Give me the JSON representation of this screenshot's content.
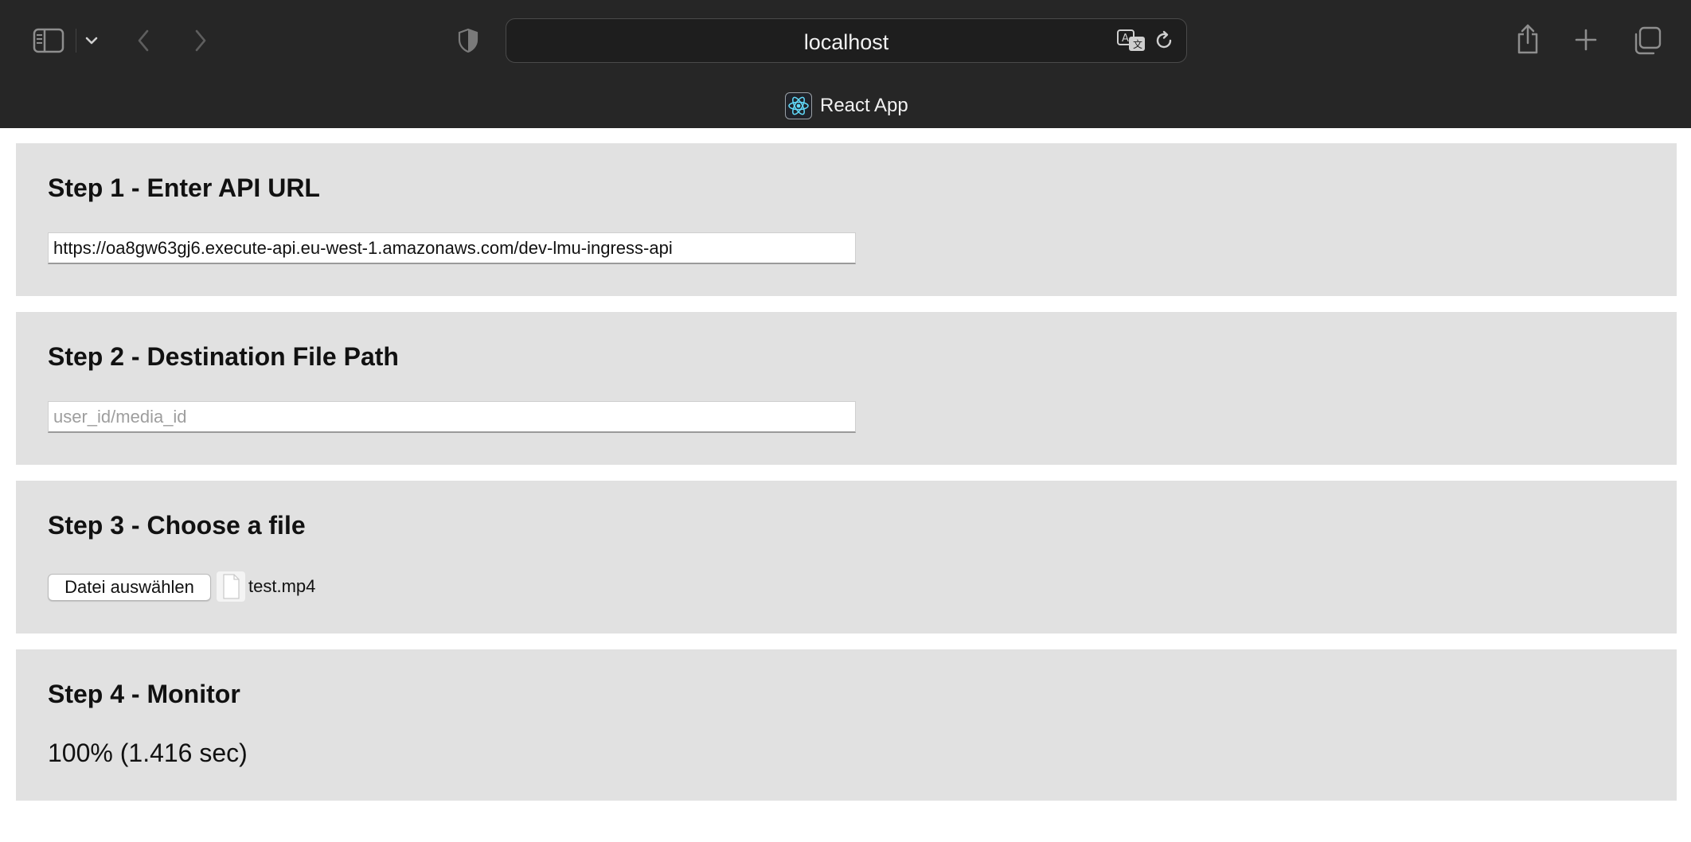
{
  "browser": {
    "url": "localhost",
    "tab_title": "React App",
    "icons": {
      "sidebar": "sidebar-icon",
      "sidebar_menu": "chevron-down-icon",
      "back": "chevron-left-icon",
      "forward": "chevron-right-icon",
      "privacy": "shield-icon",
      "translate": "translate-icon",
      "reload": "reload-icon",
      "share": "share-icon",
      "new_tab": "plus-icon",
      "tab_overview": "tabs-overview-icon",
      "favicon": "react-logo-icon"
    }
  },
  "steps": [
    {
      "title": "Step 1 - Enter API URL",
      "input_value": "https://oa8gw63gj6.execute-api.eu-west-1.amazonaws.com/dev-lmu-ingress-api"
    },
    {
      "title": "Step 2 - Destination File Path",
      "input_value": "",
      "placeholder": "user_id/media_id"
    },
    {
      "title": "Step 3 - Choose a file",
      "button_label": "Datei auswählen",
      "file_name": "test.mp4",
      "file_icon": "document-icon"
    },
    {
      "title": "Step 4 - Monitor",
      "status": "100% (1.416 sec)"
    }
  ],
  "colors": {
    "chrome_bg": "#262626",
    "card_bg": "#e1e1e1",
    "react_cyan": "#61dafb"
  }
}
